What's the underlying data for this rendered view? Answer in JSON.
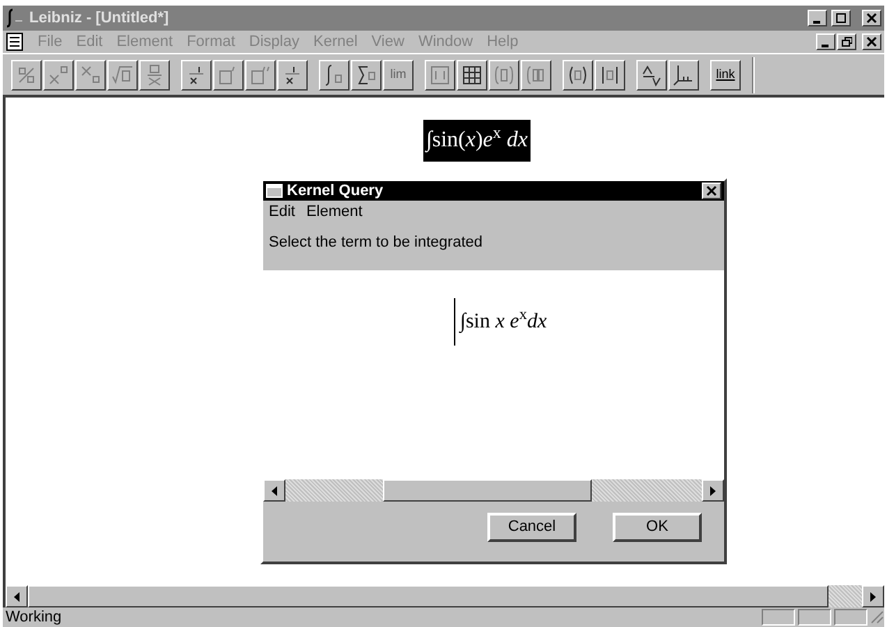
{
  "window": {
    "title": "Leibniz - [Untitled*]",
    "active": false
  },
  "menu": [
    {
      "label": "File",
      "disabled": true
    },
    {
      "label": "Edit",
      "disabled": true
    },
    {
      "label": "Element",
      "disabled": true
    },
    {
      "label": "Format",
      "disabled": true
    },
    {
      "label": "Display",
      "disabled": true
    },
    {
      "label": "Kernel",
      "disabled": true
    },
    {
      "label": "View",
      "disabled": true
    },
    {
      "label": "Window",
      "disabled": true
    },
    {
      "label": "Help",
      "disabled": true
    }
  ],
  "toolbar": {
    "lim_label": "lim",
    "link_label": "link"
  },
  "document": {
    "formula": "∫sin(*x*)*e*$^{x}$ *dx*",
    "selected": true
  },
  "dialog": {
    "title": "Kernel Query",
    "active": true,
    "menu": [
      {
        "label": "Edit"
      },
      {
        "label": "Element"
      }
    ],
    "prompt": "Select the term to be integrated",
    "formula": "∫sin *x* *e*$^{x}$*dx*",
    "buttons": [
      "Cancel",
      "OK"
    ]
  },
  "status_bar": {
    "text": "Working"
  }
}
